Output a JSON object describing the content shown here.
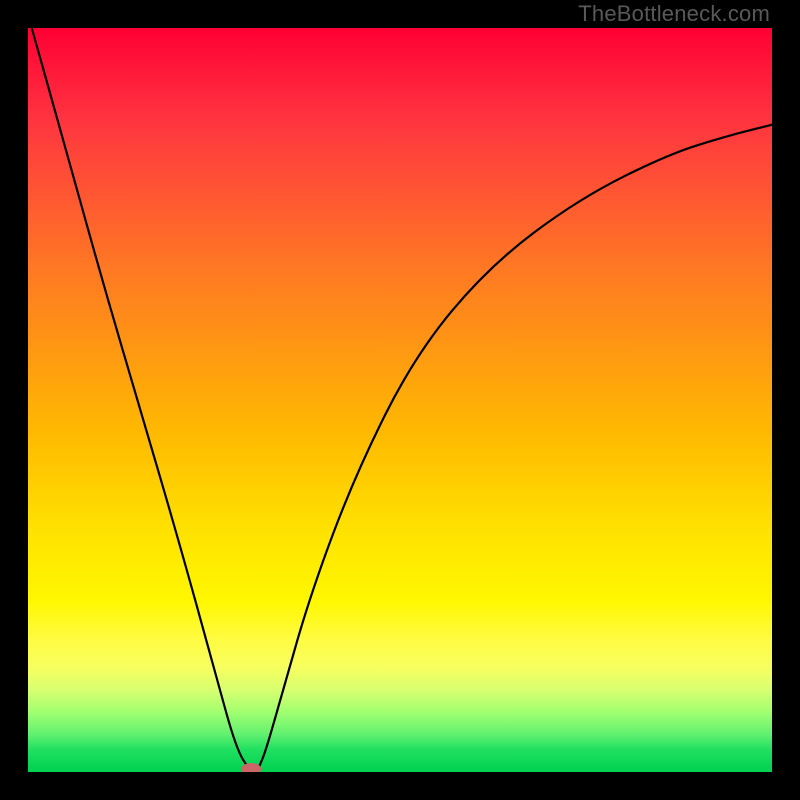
{
  "attribution": "TheBottleneck.com",
  "chart_data": {
    "type": "line",
    "title": "",
    "xlabel": "",
    "ylabel": "",
    "x_range": [
      0,
      100
    ],
    "y_range": [
      0,
      100
    ],
    "grid": false,
    "legend": false,
    "series": [
      {
        "name": "bottleneck-curve",
        "x": [
          0.5,
          5,
          10,
          15,
          20,
          25,
          28,
          30,
          30.5,
          31,
          32,
          34,
          38,
          44,
          52,
          62,
          74,
          86,
          94,
          100
        ],
        "y": [
          100,
          84,
          66,
          49,
          32,
          14,
          3,
          0,
          0,
          0.5,
          3,
          10,
          24,
          40,
          56,
          68,
          77,
          83,
          85.5,
          87
        ]
      }
    ],
    "marker": {
      "x": 30,
      "y": 0,
      "color": "#cc6666"
    },
    "gradient_stops": [
      {
        "pos": 0,
        "color": "#ff0033"
      },
      {
        "pos": 50,
        "color": "#ffbb00"
      },
      {
        "pos": 80,
        "color": "#fff700"
      },
      {
        "pos": 100,
        "color": "#00d050"
      }
    ]
  }
}
